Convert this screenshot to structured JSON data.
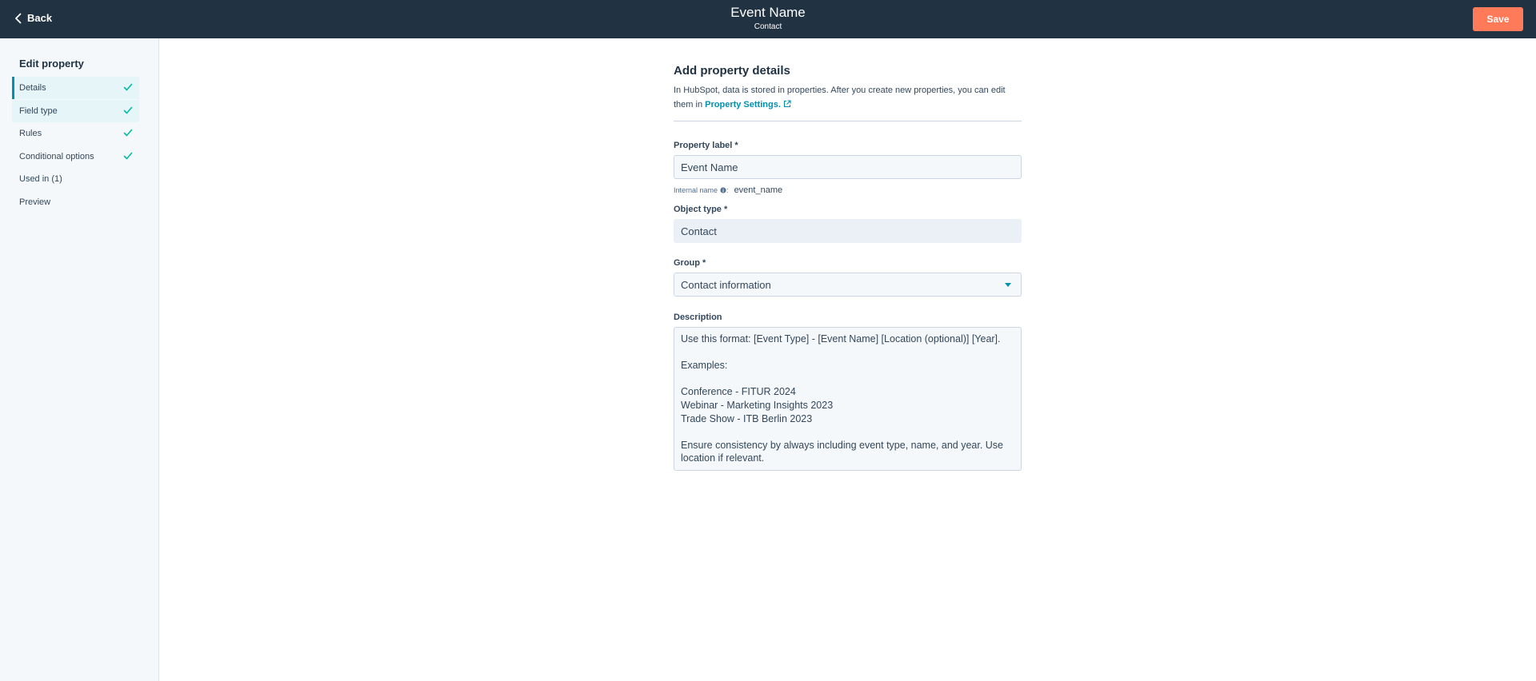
{
  "header": {
    "back_label": "Back",
    "title": "Event Name",
    "subtitle": "Contact",
    "save_label": "Save"
  },
  "sidebar": {
    "title": "Edit property",
    "items": [
      {
        "label": "Details",
        "checked": true,
        "active": true
      },
      {
        "label": "Field type",
        "checked": true,
        "active": false
      },
      {
        "label": "Rules",
        "checked": true,
        "active": false
      },
      {
        "label": "Conditional options",
        "checked": true,
        "active": false
      },
      {
        "label": "Used in (1)",
        "checked": false,
        "active": false
      },
      {
        "label": "Preview",
        "checked": false,
        "active": false
      }
    ]
  },
  "form": {
    "title": "Add property details",
    "intro_text": "In HubSpot, data is stored in properties. After you create new properties, you can edit them in",
    "intro_link": "Property Settings.",
    "property_label": {
      "label": "Property label *",
      "value": "Event Name"
    },
    "internal_name": {
      "label": "Internal name",
      "value": "event_name"
    },
    "object_type": {
      "label": "Object type *",
      "value": "Contact"
    },
    "group": {
      "label": "Group *",
      "value": "Contact information"
    },
    "description": {
      "label": "Description",
      "lines": [
        "Use this format: [Event Type] - [Event Name] [Location (optional)] [Year].",
        "",
        "Examples:",
        "",
        "Conference - FITUR 2024",
        "Webinar - Marketing Insights 2023",
        "Trade Show - ITB Berlin 2023",
        "",
        "Ensure consistency by always including event type, name, and year. Use",
        "location if relevant."
      ]
    }
  },
  "colors": {
    "header_bg": "#213343",
    "save_button": "#ff7a59",
    "accent": "#0091ae",
    "check": "#00bda5",
    "sidebar_bg": "#f5f8fa",
    "nav_selected_bg": "#e5f5f8"
  },
  "icons": {
    "back": "chevron-left-icon",
    "check": "checkmark-icon",
    "external_link": "external-link-icon",
    "info": "info-icon",
    "dropdown": "caret-down-icon"
  }
}
